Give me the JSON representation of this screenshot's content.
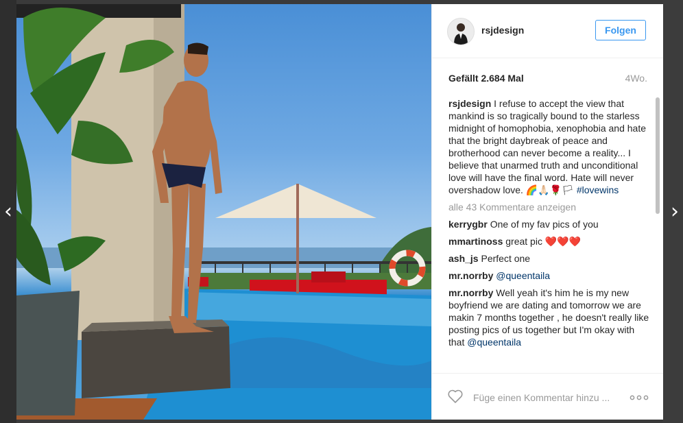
{
  "nav": {
    "prev_icon": "chevron-left-icon",
    "next_icon": "chevron-right-icon",
    "prev_glyph": "‹",
    "next_glyph": "›"
  },
  "post": {
    "username": "rsjdesign",
    "follow_label": "Folgen",
    "likes": "Gefällt 2.684 Mal",
    "time_ago": "4Wo.",
    "caption": "I refuse to accept the view that mankind is so tragically bound to the starless midnight of homophobia, xenophobia and hate that the bright daybreak of peace and brotherhood can never become a reality... I believe that unarmed truth and unconditional love will have the final word. Hate will never overshadow love. 🌈🙏🏻🌹🏳",
    "hashtag": "#lovewins",
    "load_more": "alle 43 Kommentare anzeigen",
    "comments": [
      {
        "user": "kerrygbr",
        "text": "One of my fav pics of you"
      },
      {
        "user": "mmartinoss",
        "text": "great pic ❤️❤️❤️"
      },
      {
        "user": "ash_js",
        "text": "Perfect one"
      },
      {
        "user": "mr.norrby",
        "text": "@queentaila"
      },
      {
        "user": "mr.norrby",
        "text": "Well yeah it's him he is my new boyfriend we are dating and tomorrow we are makin 7 months together , he doesn't really like posting pics of us together but I'm okay with that",
        "mention": "@queentaila"
      }
    ],
    "comment_placeholder": "Füge einen Kommentar hinzu ...",
    "colors": {
      "accent": "#3897f0",
      "link": "#003569",
      "muted": "#999999"
    }
  }
}
